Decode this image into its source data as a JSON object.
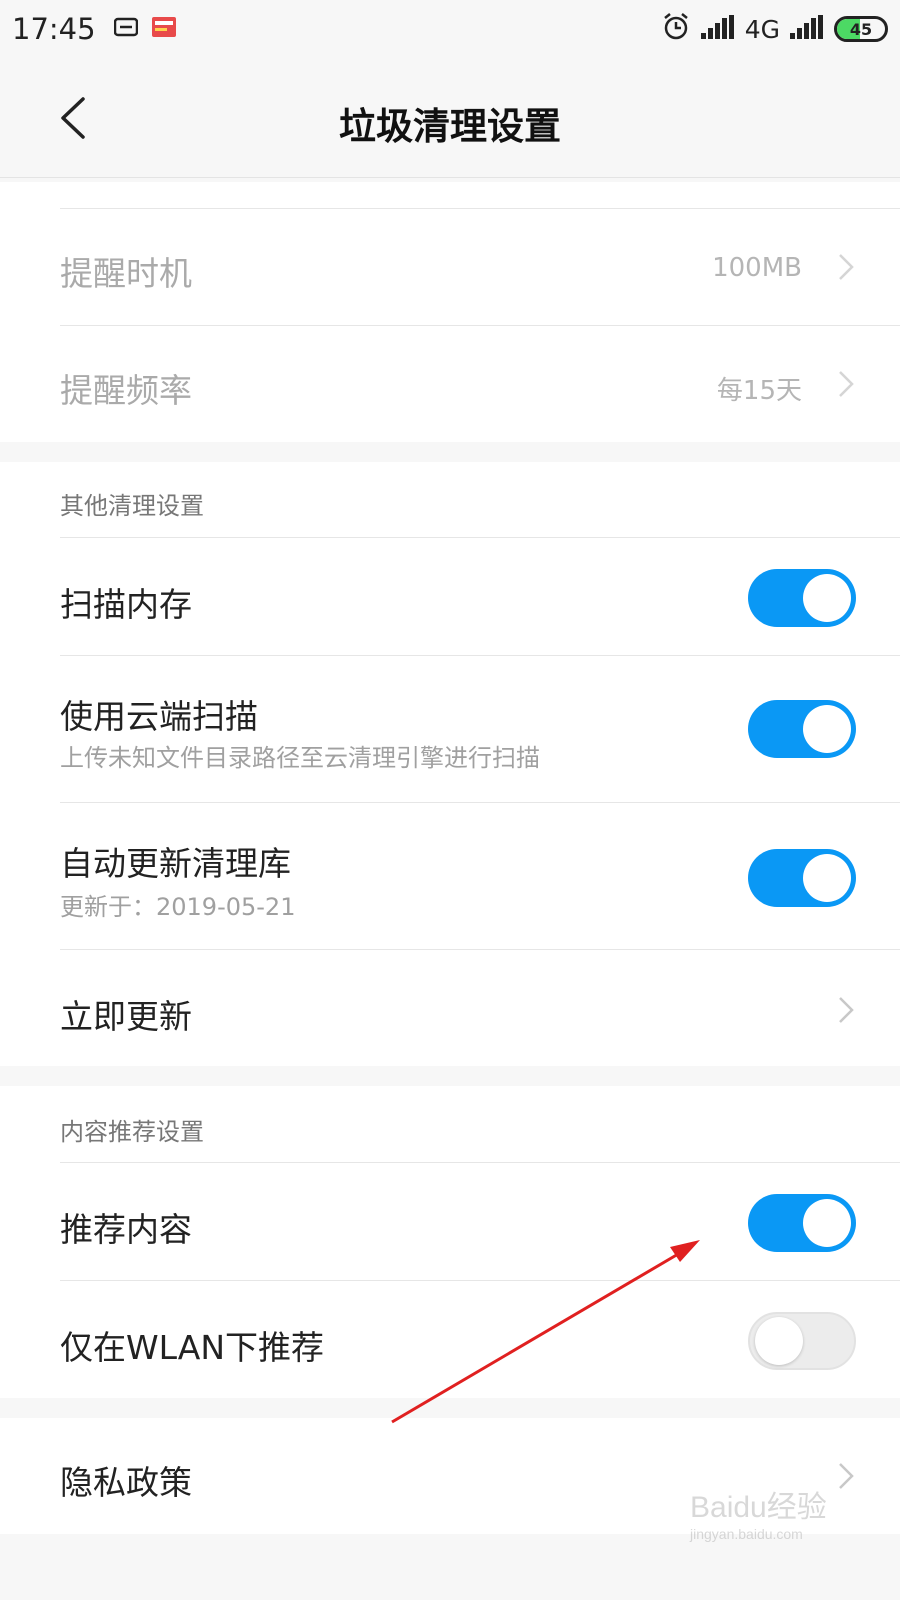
{
  "status_bar": {
    "time": "17:45",
    "network": "4G",
    "battery": "45",
    "icons": [
      "voicemail-icon",
      "toutiao-app-icon",
      "alarm-icon",
      "signal-icon",
      "signal-icon-2",
      "battery-icon"
    ]
  },
  "header": {
    "title": "垃圾清理设置",
    "back_icon": "chevron-left-icon"
  },
  "reminder": {
    "items": [
      {
        "label": "提醒时机",
        "value": "100MB"
      },
      {
        "label": "提醒频率",
        "value": "每15天"
      }
    ]
  },
  "other_settings": {
    "title": "其他清理设置",
    "scan_memory": {
      "label": "扫描内存",
      "enabled": true
    },
    "cloud_scan": {
      "label": "使用云端扫描",
      "sub": "上传未知文件目录路径至云清理引擎进行扫描",
      "enabled": true
    },
    "auto_update": {
      "label": "自动更新清理库",
      "sub": "更新于：2019-05-21",
      "enabled": true
    },
    "update_now": {
      "label": "立即更新"
    }
  },
  "recommend_settings": {
    "title": "内容推荐设置",
    "recommend": {
      "label": "推荐内容",
      "enabled": true
    },
    "wlan_only": {
      "label": "仅在WLAN下推荐",
      "enabled": false
    }
  },
  "privacy": {
    "label": "隐私政策"
  },
  "watermark": {
    "text": "Baidu经验",
    "sub": "jingyan.baidu.com"
  },
  "colors": {
    "toggle_on": "#0a98f5",
    "annotation_arrow": "#e02020"
  }
}
